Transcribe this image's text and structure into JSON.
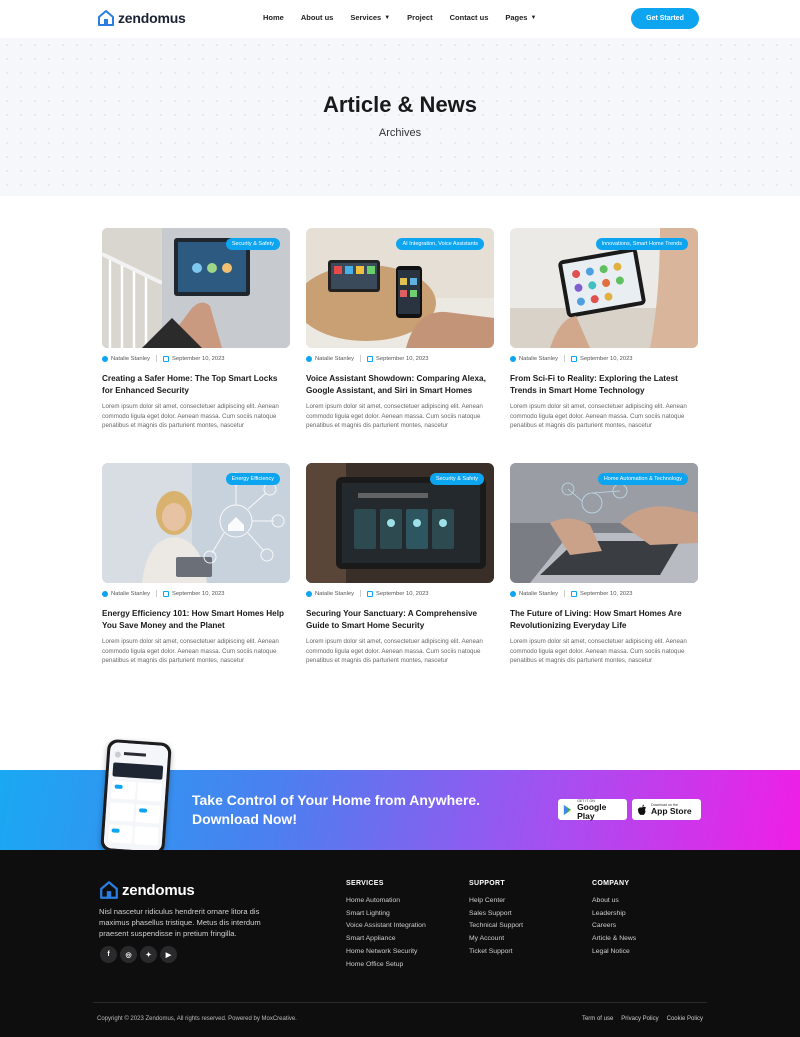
{
  "brand": {
    "name": "zendomus",
    "accent": "#0ea5f0"
  },
  "nav": {
    "items": [
      {
        "label": "Home",
        "dropdown": false
      },
      {
        "label": "About us",
        "dropdown": false
      },
      {
        "label": "Services",
        "dropdown": true
      },
      {
        "label": "Project",
        "dropdown": false
      },
      {
        "label": "Contact us",
        "dropdown": false
      },
      {
        "label": "Pages",
        "dropdown": true
      }
    ],
    "cta": "Get Started"
  },
  "hero": {
    "title": "Article & News",
    "subtitle": "Archives"
  },
  "posts": [
    {
      "category": "Security & Safety",
      "author": "Natalie Stanley",
      "date": "September 10, 2023",
      "title": "Creating a Safer Home: The Top Smart Locks for Enhanced Security",
      "excerpt": "Lorem ipsum dolor sit amet, consectetuer adipiscing elit. Aenean commodo ligula eget dolor. Aenean massa. Cum sociis natoque penatibus et magnis dis parturient montes, nascetur"
    },
    {
      "category": "AI Integration, Voice Assistants",
      "author": "Natalie Stanley",
      "date": "September 10, 2023",
      "title": "Voice Assistant Showdown: Comparing Alexa, Google Assistant, and Siri in Smart Homes",
      "excerpt": "Lorem ipsum dolor sit amet, consectetuer adipiscing elit. Aenean commodo ligula eget dolor. Aenean massa. Cum sociis natoque penatibus et magnis dis parturient montes, nascetur"
    },
    {
      "category": "Innovations, Smart Home Trends",
      "author": "Natalie Stanley",
      "date": "September 10, 2023",
      "title": "From Sci-Fi to Reality: Exploring the Latest Trends in Smart Home Technology",
      "excerpt": "Lorem ipsum dolor sit amet, consectetuer adipiscing elit. Aenean commodo ligula eget dolor. Aenean massa. Cum sociis natoque penatibus et magnis dis parturient montes, nascetur"
    },
    {
      "category": "Energy Efficiency",
      "author": "Natalie Stanley",
      "date": "September 10, 2023",
      "title": "Energy Efficiency 101: How Smart Homes Help You Save Money and the Planet",
      "excerpt": "Lorem ipsum dolor sit amet, consectetuer adipiscing elit. Aenean commodo ligula eget dolor. Aenean massa. Cum sociis natoque penatibus et magnis dis parturient montes, nascetur"
    },
    {
      "category": "Security & Safety",
      "author": "Natalie Stanley",
      "date": "September 10, 2023",
      "title": "Securing Your Sanctuary: A Comprehensive Guide to Smart Home Security",
      "excerpt": "Lorem ipsum dolor sit amet, consectetuer adipiscing elit. Aenean commodo ligula eget dolor. Aenean massa. Cum sociis natoque penatibus et magnis dis parturient montes, nascetur"
    },
    {
      "category": "Home Automation & Technology",
      "author": "Natalie Stanley",
      "date": "September 10, 2023",
      "title": "The Future of Living: How Smart Homes Are Revolutionizing Everyday Life",
      "excerpt": "Lorem ipsum dolor sit amet, consectetuer adipiscing elit. Aenean commodo ligula eget dolor. Aenean massa. Cum sociis natoque penatibus et magnis dis parturient montes, nascetur"
    }
  ],
  "app_banner": {
    "heading_line1": "Take Control of Your Home from Anywhere.",
    "heading_line2": "Download Now!",
    "google_small": "GET IT ON",
    "google_big": "Google Play",
    "apple_small": "Download on the",
    "apple_big": "App Store"
  },
  "footer": {
    "description": "Nisl nascetur ridiculus hendrerit ornare litora dis maximus phasellus tristique. Metus dis interdum praesent suspendisse in pretium fringilla.",
    "socials": [
      "facebook-icon",
      "instagram-icon",
      "twitter-icon",
      "youtube-icon"
    ],
    "columns": [
      {
        "title": "SERVICES",
        "links": [
          "Home Automation",
          "Smart Lighting",
          "Voice Assistant Integration",
          "Smart Appliance",
          "Home Network Security",
          "Home Office Setup"
        ]
      },
      {
        "title": "SUPPORT",
        "links": [
          "Help Center",
          "Sales Support",
          "Technical Support",
          "My Account",
          "Ticket Support"
        ]
      },
      {
        "title": "COMPANY",
        "links": [
          "About us",
          "Leadership",
          "Careers",
          "Article & News",
          "Legal Notice"
        ]
      }
    ],
    "copyright": "Copyright © 2023 Zendomus, All rights reserved. Powered by MoxCreative.",
    "legal": [
      "Term of use",
      "Privacy Policy",
      "Cookie Policy"
    ]
  }
}
